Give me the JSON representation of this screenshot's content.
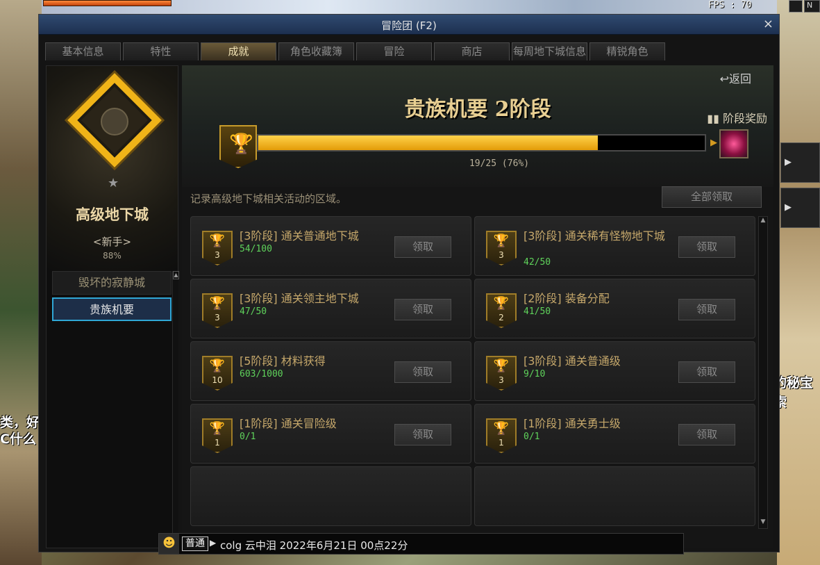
{
  "hud": {
    "fps": "FPS : 70",
    "chat_left": [
      "类，好",
      "C什么"
    ],
    "chat_right": [
      "的秘宝",
      "索"
    ]
  },
  "window": {
    "title": "冒险团 (F2)",
    "close": "×"
  },
  "tabs": [
    {
      "label": "基本信息",
      "active": false
    },
    {
      "label": "特性",
      "active": false
    },
    {
      "label": "成就",
      "active": true
    },
    {
      "label": "角色收藏簿",
      "active": false
    },
    {
      "label": "冒险",
      "active": false
    },
    {
      "label": "商店",
      "active": false
    },
    {
      "label": "每周地下城信息",
      "active": false
    },
    {
      "label": "精锐角色",
      "active": false
    }
  ],
  "sidebar": {
    "emblem_title": "高级地下城",
    "rank": "<新手>",
    "percent": "88%",
    "categories": [
      {
        "label": "毁坏的寂静城",
        "active": false
      },
      {
        "label": "贵族机要",
        "active": true
      }
    ]
  },
  "hero": {
    "back": "↩返回",
    "title": "贵族机要 2阶段",
    "stage_reward": "阶段奖励",
    "progress_label": "19/25 (76%)",
    "progress_fraction": 0.76
  },
  "description": "记录高级地下城相关活动的区域。",
  "claim_all": "全部领取",
  "achievements": [
    {
      "tier": "3",
      "title": "[3阶段] 通关普通地下城",
      "progress": "54/100",
      "claim": "领取",
      "wrap": false
    },
    {
      "tier": "3",
      "title": "[3阶段] 通关稀有怪物地下城",
      "progress": "42/50",
      "claim": "领取",
      "wrap": true
    },
    {
      "tier": "3",
      "title": "[3阶段] 通关领主地下城",
      "progress": "47/50",
      "claim": "领取",
      "wrap": false
    },
    {
      "tier": "2",
      "title": "[2阶段] 装备分配",
      "progress": "41/50",
      "claim": "领取",
      "wrap": false
    },
    {
      "tier": "10",
      "title": "[5阶段] 材料获得",
      "progress": "603/1000",
      "claim": "领取",
      "wrap": false
    },
    {
      "tier": "3",
      "title": "[3阶段] 通关普通级",
      "progress": "9/10",
      "claim": "领取",
      "wrap": false
    },
    {
      "tier": "1",
      "title": "[1阶段] 通关冒险级",
      "progress": "0/1",
      "claim": "领取",
      "wrap": false
    },
    {
      "tier": "1",
      "title": "[1阶段] 通关勇士级",
      "progress": "0/1",
      "claim": "领取",
      "wrap": false
    }
  ],
  "chat": {
    "channel": "普通",
    "message": "colg 云中泪 2022年6月21日 00点22分"
  }
}
